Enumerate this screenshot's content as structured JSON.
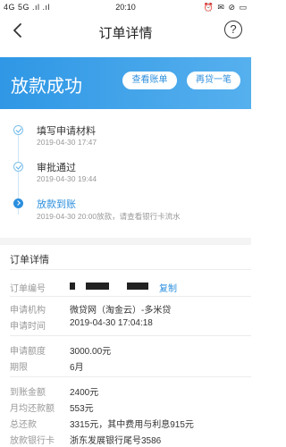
{
  "status_bar": {
    "left_text": "4G 5G .ıl .ıl",
    "time": "20:10",
    "right_text": "⏰ ✉ ⊘ ▭"
  },
  "nav": {
    "title": "订单详情",
    "help_icon_glyph": "?"
  },
  "banner": {
    "title": "放款成功",
    "btn_bill": "查看账单",
    "btn_loan": "再贷一笔",
    "color_start": "#2f97e5",
    "color_end": "#56b0ee"
  },
  "timeline": [
    {
      "title": "填写申请材料",
      "time": "2019-04-30 17:47",
      "state": "done"
    },
    {
      "title": "审批通过",
      "time": "2019-04-30 19:44",
      "state": "done"
    },
    {
      "title": "放款到账",
      "time": "2019-04-30 20:00放款，请查看银行卡流水",
      "state": "current"
    }
  ],
  "details": {
    "section_title": "订单详情",
    "order_no_label": "订单编号",
    "copy_label": "复制",
    "rows_group1": [
      {
        "label": "申请机构",
        "value": "微贷网（淘金云）-多米贷"
      },
      {
        "label": "申请时间",
        "value": "2019-04-30 17:04:18"
      }
    ],
    "rows_group2": [
      {
        "label": "申请额度",
        "value": "3000.00元"
      },
      {
        "label": "期限",
        "value": "6月"
      }
    ],
    "rows_group3": [
      {
        "label": "到账金额",
        "value": "2400元"
      },
      {
        "label": "月均还款额",
        "value": "553元"
      },
      {
        "label": "总还款",
        "value": "3315元，其中费用与利息915元"
      },
      {
        "label": "放款银行卡",
        "value": "浙东发展银行尾号3586"
      }
    ]
  },
  "accent_color": "#2b8fde"
}
